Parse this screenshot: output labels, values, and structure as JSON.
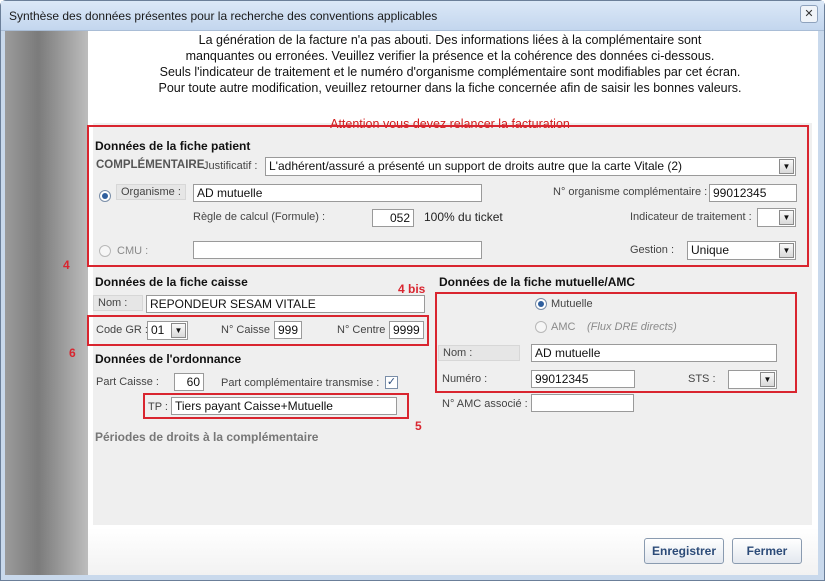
{
  "window": {
    "title": "Synthèse des données présentes pour la recherche des conventions applicables",
    "close": "✕"
  },
  "message": {
    "lines": [
      "La génération de la facture n'a pas abouti. Des informations liées à la complémentaire sont",
      "manquantes ou erronées. Veuillez verifier la présence et la cohérence des données ci-dessous.",
      "Seuls l'indicateur de traitement et le numéro d'organisme complémentaire sont modifiables par cet écran.",
      "Pour toute autre modification, veuillez retourner dans la fiche concernée afin de saisir les bonnes valeurs."
    ],
    "attention": "Attention vous devez relancer la facturation"
  },
  "patient": {
    "title": "Données de la fiche patient",
    "complementaire": "COMPLÉMENTAIRE",
    "justificatif_label": "Justificatif :",
    "justificatif_value": "L'adhérent/assuré a présenté un support de droits autre que la carte Vitale (2)",
    "organisme_label": "Organisme :",
    "organisme_value": "AD mutuelle",
    "num_org_label": "N° organisme complémentaire :",
    "num_org_value": "99012345",
    "regle_label": "Règle de calcul (Formule) :",
    "regle_value": "052",
    "regle_desc": "100% du ticket",
    "indicateur_label": "Indicateur de traitement :",
    "indicateur_value": "",
    "cmu_label": "CMU :",
    "cmu_value": "",
    "gestion_label": "Gestion :",
    "gestion_value": "Unique"
  },
  "caisse": {
    "title": "Données de la fiche caisse",
    "nom_label": "Nom :",
    "nom_value": "REPONDEUR SESAM VITALE",
    "code_gr_label": "Code GR :",
    "code_gr_value": "01",
    "num_caisse_label": "N° Caisse",
    "num_caisse_value": "999",
    "num_centre_label": "N° Centre",
    "num_centre_value": "9999"
  },
  "ordonnance": {
    "title": "Données de l'ordonnance",
    "part_caisse_label": "Part Caisse :",
    "part_caisse_value": "60",
    "part_compl_label": "Part complémentaire transmise :",
    "part_compl_checked": "✓",
    "tp_label": "TP :",
    "tp_value": "Tiers payant Caisse+Mutuelle"
  },
  "mutuelle": {
    "title": "Données de la fiche mutuelle/AMC",
    "radio_mutuelle": "Mutuelle",
    "radio_amc": "AMC",
    "flux_note": "(Flux DRE directs)",
    "nom_label": "Nom :",
    "nom_value": "AD mutuelle",
    "numero_label": "Numéro :",
    "numero_value": "99012345",
    "sts_label": "STS :",
    "sts_value": "",
    "amc_assoc_label": "N° AMC associé :",
    "amc_assoc_value": ""
  },
  "periodes": {
    "title": "Périodes de droits à la complémentaire"
  },
  "annotations": {
    "n4": "4",
    "n4bis": "4 bis",
    "n5": "5",
    "n6": "6"
  },
  "buttons": {
    "save": "Enregistrer",
    "close": "Fermer"
  },
  "icons": {
    "dropdown": "chevron-down-icon",
    "close": "close-icon"
  }
}
